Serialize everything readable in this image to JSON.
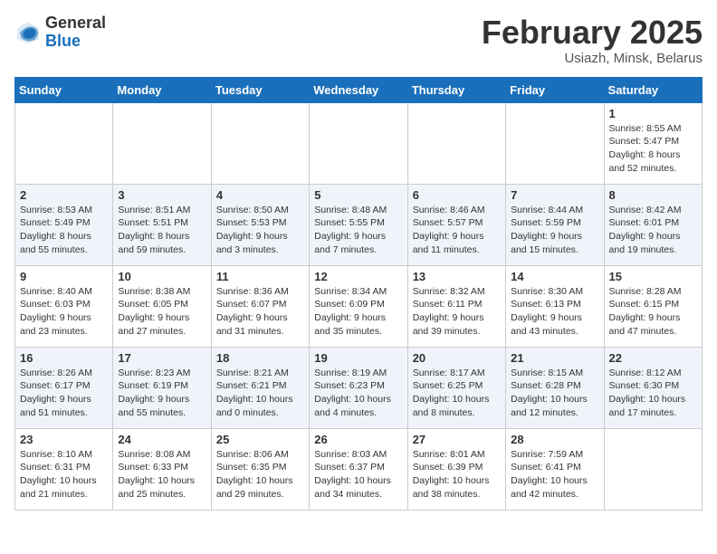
{
  "header": {
    "logo_general": "General",
    "logo_blue": "Blue",
    "month_title": "February 2025",
    "location": "Usiazh, Minsk, Belarus"
  },
  "days_of_week": [
    "Sunday",
    "Monday",
    "Tuesday",
    "Wednesday",
    "Thursday",
    "Friday",
    "Saturday"
  ],
  "weeks": [
    {
      "days": [
        {
          "number": "",
          "info": ""
        },
        {
          "number": "",
          "info": ""
        },
        {
          "number": "",
          "info": ""
        },
        {
          "number": "",
          "info": ""
        },
        {
          "number": "",
          "info": ""
        },
        {
          "number": "",
          "info": ""
        },
        {
          "number": "1",
          "info": "Sunrise: 8:55 AM\nSunset: 5:47 PM\nDaylight: 8 hours and 52 minutes."
        }
      ]
    },
    {
      "days": [
        {
          "number": "2",
          "info": "Sunrise: 8:53 AM\nSunset: 5:49 PM\nDaylight: 8 hours and 55 minutes."
        },
        {
          "number": "3",
          "info": "Sunrise: 8:51 AM\nSunset: 5:51 PM\nDaylight: 8 hours and 59 minutes."
        },
        {
          "number": "4",
          "info": "Sunrise: 8:50 AM\nSunset: 5:53 PM\nDaylight: 9 hours and 3 minutes."
        },
        {
          "number": "5",
          "info": "Sunrise: 8:48 AM\nSunset: 5:55 PM\nDaylight: 9 hours and 7 minutes."
        },
        {
          "number": "6",
          "info": "Sunrise: 8:46 AM\nSunset: 5:57 PM\nDaylight: 9 hours and 11 minutes."
        },
        {
          "number": "7",
          "info": "Sunrise: 8:44 AM\nSunset: 5:59 PM\nDaylight: 9 hours and 15 minutes."
        },
        {
          "number": "8",
          "info": "Sunrise: 8:42 AM\nSunset: 6:01 PM\nDaylight: 9 hours and 19 minutes."
        }
      ]
    },
    {
      "days": [
        {
          "number": "9",
          "info": "Sunrise: 8:40 AM\nSunset: 6:03 PM\nDaylight: 9 hours and 23 minutes."
        },
        {
          "number": "10",
          "info": "Sunrise: 8:38 AM\nSunset: 6:05 PM\nDaylight: 9 hours and 27 minutes."
        },
        {
          "number": "11",
          "info": "Sunrise: 8:36 AM\nSunset: 6:07 PM\nDaylight: 9 hours and 31 minutes."
        },
        {
          "number": "12",
          "info": "Sunrise: 8:34 AM\nSunset: 6:09 PM\nDaylight: 9 hours and 35 minutes."
        },
        {
          "number": "13",
          "info": "Sunrise: 8:32 AM\nSunset: 6:11 PM\nDaylight: 9 hours and 39 minutes."
        },
        {
          "number": "14",
          "info": "Sunrise: 8:30 AM\nSunset: 6:13 PM\nDaylight: 9 hours and 43 minutes."
        },
        {
          "number": "15",
          "info": "Sunrise: 8:28 AM\nSunset: 6:15 PM\nDaylight: 9 hours and 47 minutes."
        }
      ]
    },
    {
      "days": [
        {
          "number": "16",
          "info": "Sunrise: 8:26 AM\nSunset: 6:17 PM\nDaylight: 9 hours and 51 minutes."
        },
        {
          "number": "17",
          "info": "Sunrise: 8:23 AM\nSunset: 6:19 PM\nDaylight: 9 hours and 55 minutes."
        },
        {
          "number": "18",
          "info": "Sunrise: 8:21 AM\nSunset: 6:21 PM\nDaylight: 10 hours and 0 minutes."
        },
        {
          "number": "19",
          "info": "Sunrise: 8:19 AM\nSunset: 6:23 PM\nDaylight: 10 hours and 4 minutes."
        },
        {
          "number": "20",
          "info": "Sunrise: 8:17 AM\nSunset: 6:25 PM\nDaylight: 10 hours and 8 minutes."
        },
        {
          "number": "21",
          "info": "Sunrise: 8:15 AM\nSunset: 6:28 PM\nDaylight: 10 hours and 12 minutes."
        },
        {
          "number": "22",
          "info": "Sunrise: 8:12 AM\nSunset: 6:30 PM\nDaylight: 10 hours and 17 minutes."
        }
      ]
    },
    {
      "days": [
        {
          "number": "23",
          "info": "Sunrise: 8:10 AM\nSunset: 6:31 PM\nDaylight: 10 hours and 21 minutes."
        },
        {
          "number": "24",
          "info": "Sunrise: 8:08 AM\nSunset: 6:33 PM\nDaylight: 10 hours and 25 minutes."
        },
        {
          "number": "25",
          "info": "Sunrise: 8:06 AM\nSunset: 6:35 PM\nDaylight: 10 hours and 29 minutes."
        },
        {
          "number": "26",
          "info": "Sunrise: 8:03 AM\nSunset: 6:37 PM\nDaylight: 10 hours and 34 minutes."
        },
        {
          "number": "27",
          "info": "Sunrise: 8:01 AM\nSunset: 6:39 PM\nDaylight: 10 hours and 38 minutes."
        },
        {
          "number": "28",
          "info": "Sunrise: 7:59 AM\nSunset: 6:41 PM\nDaylight: 10 hours and 42 minutes."
        },
        {
          "number": "",
          "info": ""
        }
      ]
    }
  ]
}
